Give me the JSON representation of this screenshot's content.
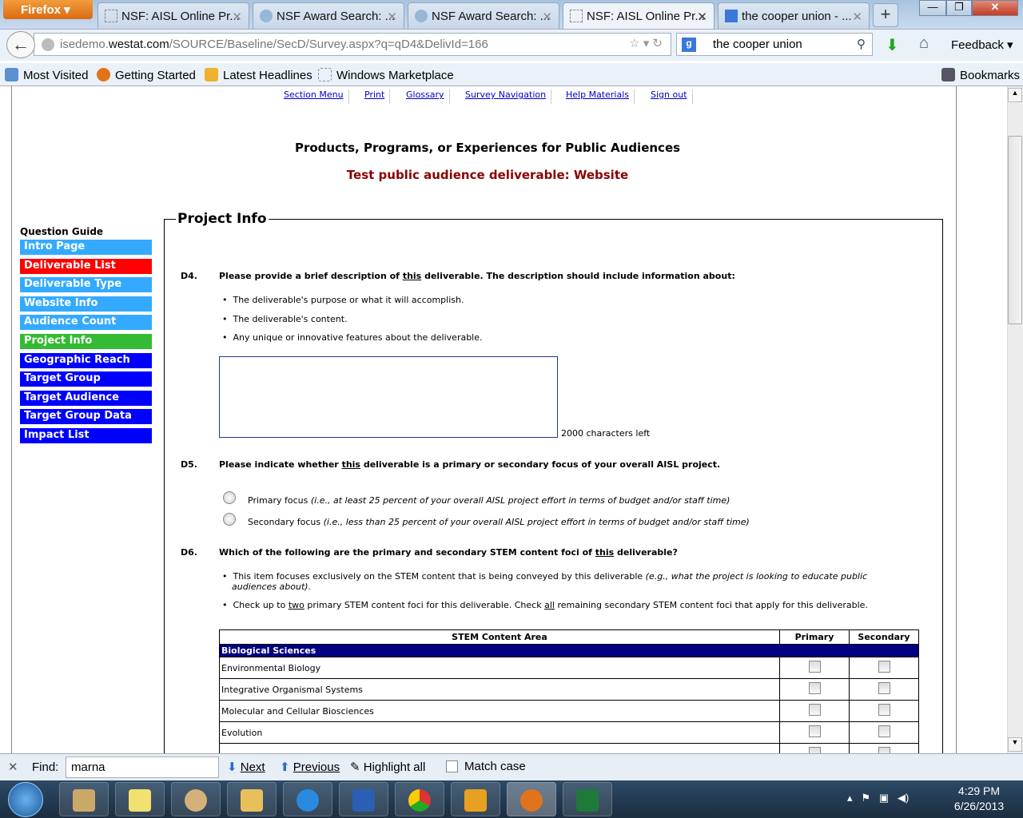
{
  "browser": {
    "menu": "Firefox",
    "tabs": [
      {
        "title": "NSF: AISL Online Pr..."
      },
      {
        "title": "NSF Award Search: ..."
      },
      {
        "title": "NSF Award Search: ..."
      },
      {
        "title": "NSF: AISL Online Pr..."
      },
      {
        "title": "the cooper union - ..."
      }
    ],
    "url_domain_pre": "isedemo.",
    "url_domain": "westat.com",
    "url_path": "/SOURCE/Baseline/SecD/Survey.aspx?q=qD4&DelivId=166",
    "search_value": "the cooper union",
    "feedback": "Feedback",
    "bookmarks": [
      "Most Visited",
      "Getting Started",
      "Latest Headlines",
      "Windows Marketplace"
    ],
    "bookmarks_menu": "Bookmarks"
  },
  "topnav": [
    "Section Menu",
    "Print",
    "Glossary",
    "Survey Navigation",
    "Help Materials",
    "Sign out"
  ],
  "header": {
    "title": "Products, Programs, or Experiences for Public Audiences",
    "subtitle": "Test public audience deliverable: Website"
  },
  "sidebar": {
    "heading": "Question Guide",
    "items": [
      {
        "label": "Intro Page",
        "color": "#33aaff"
      },
      {
        "label": "Deliverable List",
        "color": "#ff0000"
      },
      {
        "label": "Deliverable Type",
        "color": "#33aaff"
      },
      {
        "label": "Website Info",
        "color": "#33aaff"
      },
      {
        "label": "Audience Count",
        "color": "#33aaff"
      },
      {
        "label": "Project Info",
        "color": "#33bb33"
      },
      {
        "label": "Geographic Reach",
        "color": "#0000ff"
      },
      {
        "label": "Target Group",
        "color": "#0000ff"
      },
      {
        "label": "Target Audience",
        "color": "#0000ff"
      },
      {
        "label": "Target Group Data",
        "color": "#0000ff"
      },
      {
        "label": "Impact List",
        "color": "#0000ff"
      }
    ]
  },
  "section": {
    "legend": "Project Info"
  },
  "d4": {
    "num": "D4.",
    "q_pre": "Please provide a brief description of ",
    "q_u": "this",
    "q_post": " deliverable. The description should include information about:",
    "bullets": [
      "The deliverable's purpose or what it will accomplish.",
      "The deliverable's content.",
      "Any unique or innovative features about the deliverable."
    ],
    "value": "",
    "chars_left": "2000 characters left"
  },
  "d5": {
    "num": "D5.",
    "q_pre": "Please indicate whether ",
    "q_u": "this",
    "q_post": " deliverable is a primary or secondary focus of your overall AISL project.",
    "options": [
      {
        "label": "Primary focus ",
        "note": "(i.e., at least 25 percent of your overall AISL project effort in terms of budget and/or staff time)"
      },
      {
        "label": "Secondary focus ",
        "note": "(i.e., less than 25 percent of your overall AISL project effort in terms of budget and/or staff time)"
      }
    ]
  },
  "d6": {
    "num": "D6.",
    "q_pre": "Which of the following are the primary and secondary STEM content foci of ",
    "q_u": "this",
    "q_post": " deliverable?",
    "b1": "This item focuses exclusively on the STEM content that is being conveyed by this deliverable ",
    "b1_note": "(e.g., what the project is looking to educate public audiences about).",
    "b2_a": "Check up to ",
    "b2_u1": "two",
    "b2_b": " primary STEM content foci for this deliverable. Check ",
    "b2_u2": "all",
    "b2_c": " remaining secondary STEM content foci that apply for this deliverable.",
    "table": {
      "headers": [
        "STEM Content Area",
        "Primary",
        "Secondary"
      ],
      "group": "Biological Sciences",
      "rows": [
        "Environmental Biology",
        "Integrative Organismal Systems",
        "Molecular and Cellular Biosciences",
        "Evolution"
      ]
    }
  },
  "findbar": {
    "label": "Find:",
    "value": "marna",
    "next": "Next",
    "previous": "Previous",
    "highlight": "Highlight all",
    "match_case": "Match case"
  },
  "taskbar": {
    "time": "4:29 PM",
    "date": "6/26/2013"
  }
}
